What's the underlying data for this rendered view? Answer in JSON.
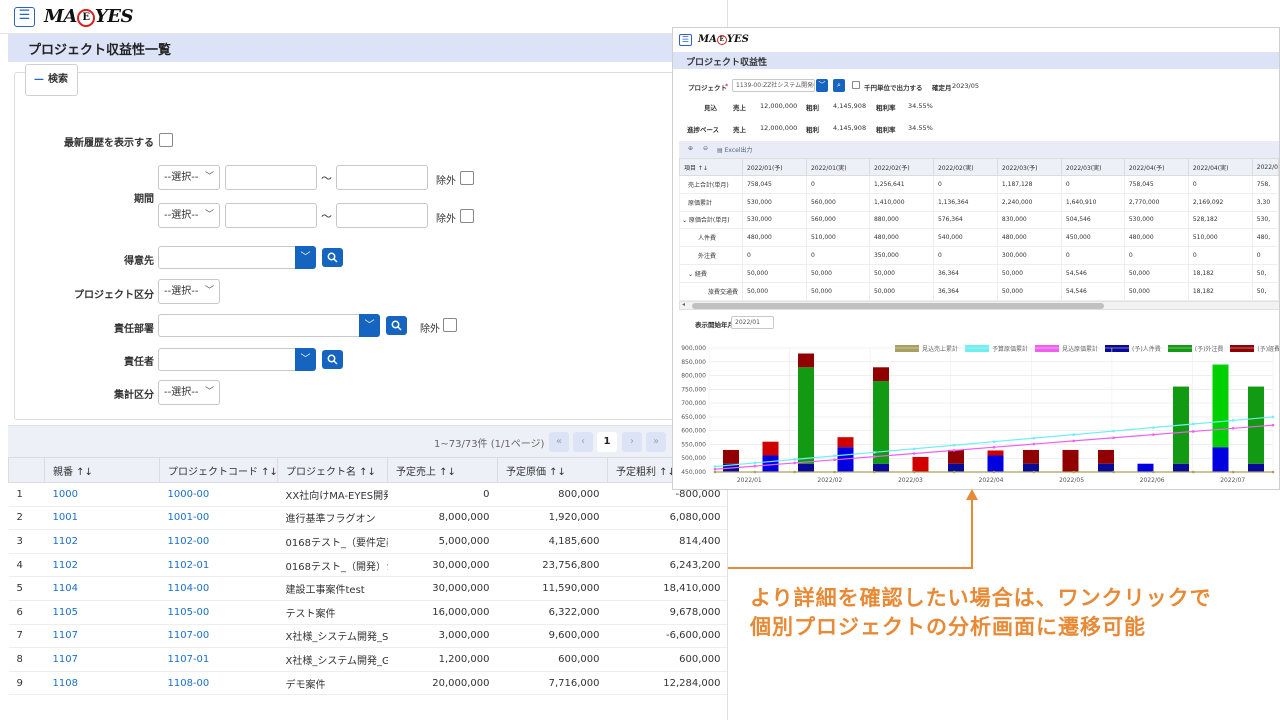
{
  "left": {
    "logo_text": "MA",
    "logo_mid": "E",
    "logo_tail": "YES",
    "page_title": "プロジェクト収益性一覧",
    "search_tab_label": "検索",
    "latest_history_label": "最新履歴を表示する",
    "period_label": "期間",
    "select_placeholder": "--選択--",
    "tilde": "～",
    "exclude_label": "除外",
    "customer_label": "得意先",
    "project_category_label": "プロジェクト区分",
    "department_label": "責任部署",
    "manager_label": "責任者",
    "aggregate_label": "集計区分",
    "pager": {
      "count_text": "1~73/73件 (1/1ページ)",
      "current_page": "1"
    },
    "columns": [
      "",
      "親番 ↑↓",
      "プロジェクトコード ↑↓",
      "プロジェクト名 ↑↓",
      "予定売上 ↑↓",
      "予定原価 ↑↓",
      "予定粗利 ↑↓"
    ],
    "rows": [
      [
        "1",
        "1000",
        "1000-00",
        "XX社向けMA-EYES開発",
        "0",
        "800,000",
        "-800,000"
      ],
      [
        "2",
        "1001",
        "1001-00",
        "進行基準フラグオン",
        "8,000,000",
        "1,920,000",
        "6,080,000"
      ],
      [
        "3",
        "1102",
        "1102-00",
        "0168テスト_（要件定義）",
        "5,000,000",
        "4,185,600",
        "814,400"
      ],
      [
        "4",
        "1102",
        "1102-01",
        "0168テスト_（開発）シ",
        "30,000,000",
        "23,756,800",
        "6,243,200"
      ],
      [
        "5",
        "1104",
        "1104-00",
        "建設工事案件test",
        "30,000,000",
        "11,590,000",
        "18,410,000"
      ],
      [
        "6",
        "1105",
        "1105-00",
        "テスト案件",
        "16,000,000",
        "6,322,000",
        "9,678,000"
      ],
      [
        "7",
        "1107",
        "1107-00",
        "X社様_システム開発_SI",
        "3,000,000",
        "9,600,000",
        "-6,600,000"
      ],
      [
        "8",
        "1107",
        "1107-01",
        "X社様_システム開発_GC",
        "1,200,000",
        "600,000",
        "600,000"
      ],
      [
        "9",
        "1108",
        "1108-00",
        "デモ案件",
        "20,000,000",
        "7,716,000",
        "12,284,000"
      ]
    ]
  },
  "right": {
    "logo_text": "MA",
    "logo_mid": "E",
    "logo_tail": "YES",
    "page_title": "プロジェクト収益性",
    "project_label": "プロジェクト",
    "project_value": "1139-00:ZZ社システム開発(",
    "thousand_unit_label": "千円単位で出力する",
    "confirmed_month_label": "確定月",
    "confirmed_month_value": "2023/05",
    "forecast_label": "見込",
    "progress_label": "進捗ベース",
    "sales_label": "売上",
    "sales_value": "12,000,000",
    "gross_label": "粗利",
    "gross_value": "4,145,908",
    "gross_rate_label": "粗利率",
    "gross_rate_value": "34.55%",
    "excel_label": "Excel出力",
    "columns": [
      "項目 ↑↓",
      "2022/01(予)",
      "2022/01(実)",
      "2022/02(予)",
      "2022/02(実)",
      "2022/03(予)",
      "2022/03(実)",
      "2022/04(予)",
      "2022/04(実)",
      "2022/0"
    ],
    "rows": [
      [
        "売上合計(単月)",
        "758,045",
        "0",
        "1,256,641",
        "0",
        "1,187,128",
        "0",
        "758,045",
        "0",
        "758,"
      ],
      [
        "原価累計",
        "530,000",
        "560,000",
        "1,410,000",
        "1,136,364",
        "2,240,000",
        "1,640,910",
        "2,770,000",
        "2,169,092",
        "3,30"
      ],
      [
        "⌄ 原価合計(単月)",
        "530,000",
        "560,000",
        "880,000",
        "576,364",
        "830,000",
        "504,546",
        "530,000",
        "528,182",
        "530,"
      ],
      [
        "人件費",
        "480,000",
        "510,000",
        "480,000",
        "540,000",
        "480,000",
        "450,000",
        "480,000",
        "510,000",
        "480,"
      ],
      [
        "外注費",
        "0",
        "0",
        "350,000",
        "0",
        "300,000",
        "0",
        "0",
        "0",
        "0"
      ],
      [
        "⌄ 経費",
        "50,000",
        "50,000",
        "50,000",
        "36,364",
        "50,000",
        "54,546",
        "50,000",
        "18,182",
        "50,"
      ],
      [
        "旅費交通費",
        "50,000",
        "50,000",
        "50,000",
        "36,364",
        "50,000",
        "54,546",
        "50,000",
        "18,182",
        "50,"
      ]
    ],
    "display_start_label": "表示開始年月",
    "display_start_value": "2022/01"
  },
  "chart_data": {
    "type": "bar",
    "categories": [
      "2022/01",
      "2022/02",
      "2022/03",
      "2022/04",
      "2022/05",
      "2022/06",
      "2022/07"
    ],
    "ylim": [
      450000,
      900000
    ],
    "yticks": [
      "900,000",
      "850,000",
      "800,000",
      "750,000",
      "700,000",
      "650,000",
      "600,000",
      "550,000",
      "500,000",
      "450,000"
    ],
    "legend": [
      {
        "name": "見込売上累計",
        "color": "#a8a060"
      },
      {
        "name": "予算原価累計",
        "color": "#6ef0f0"
      },
      {
        "name": "見込原価累計",
        "color": "#f060f0"
      },
      {
        "name": "(予)人件費",
        "color": "#0a0a9a"
      },
      {
        "name": "(予)外注費",
        "color": "#139a13"
      },
      {
        "name": "(予)経費",
        "color": "#900000"
      }
    ],
    "bars": [
      {
        "stack": [
          [
            "#0a0a9a",
            480000
          ],
          [
            "#900000",
            530000
          ]
        ]
      },
      {
        "stack": [
          [
            "#0000e0",
            510000
          ],
          [
            "#d00000",
            560000
          ]
        ]
      },
      {
        "stack": [
          [
            "#0a0a9a",
            480000
          ],
          [
            "#139a13",
            830000
          ],
          [
            "#900000",
            880000
          ]
        ]
      },
      {
        "stack": [
          [
            "#0000e0",
            540000
          ],
          [
            "#d00000",
            576364
          ]
        ]
      },
      {
        "stack": [
          [
            "#0a0a9a",
            480000
          ],
          [
            "#139a13",
            780000
          ],
          [
            "#900000",
            830000
          ]
        ]
      },
      {
        "stack": [
          [
            "#d00000",
            504546
          ]
        ]
      },
      {
        "stack": [
          [
            "#0a0a9a",
            480000
          ],
          [
            "#900000",
            530000
          ]
        ]
      },
      {
        "stack": [
          [
            "#0000e0",
            510000
          ],
          [
            "#d00000",
            528182
          ]
        ]
      },
      {
        "stack": [
          [
            "#0a0a9a",
            480000
          ],
          [
            "#900000",
            530000
          ]
        ]
      },
      {
        "stack": [
          [
            "#900000",
            530000
          ]
        ]
      },
      {
        "stack": [
          [
            "#0a0a9a",
            480000
          ],
          [
            "#900000",
            530000
          ]
        ]
      },
      {
        "stack": [
          [
            "#0000e0",
            480000
          ]
        ]
      },
      {
        "stack": [
          [
            "#0a0a9a",
            480000
          ],
          [
            "#139a13",
            760000
          ]
        ]
      },
      {
        "stack": [
          [
            "#0000e0",
            540000
          ],
          [
            "#00d000",
            840000
          ]
        ]
      },
      {
        "stack": [
          [
            "#0a0a9a",
            480000
          ],
          [
            "#139a13",
            760000
          ]
        ]
      }
    ],
    "lines": [
      {
        "name": "予算原価累計",
        "color": "#6ef0f0",
        "from": 470000,
        "to": 650000
      },
      {
        "name": "見込原価累計",
        "color": "#f060f0",
        "from": 460000,
        "to": 620000
      },
      {
        "name": "見込売上累計",
        "color": "#a8a060",
        "from": 450000,
        "to": 450000
      }
    ]
  },
  "callout": {
    "line1": "より詳細を確認したい場合は、ワンクリックで",
    "line2": "個別プロジェクトの分析画面に遷移可能",
    "color": "#e88a35"
  }
}
